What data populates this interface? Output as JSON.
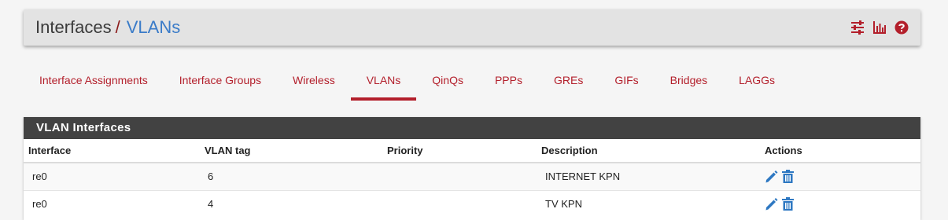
{
  "breadcrumb": {
    "base": "Interfaces",
    "separator": "/",
    "current": "VLANs"
  },
  "header_icons": [
    "settings-sliders-icon",
    "bar-chart-icon",
    "help-icon"
  ],
  "tabs": [
    {
      "label": "Interface Assignments",
      "active": false
    },
    {
      "label": "Interface Groups",
      "active": false
    },
    {
      "label": "Wireless",
      "active": false
    },
    {
      "label": "VLANs",
      "active": true
    },
    {
      "label": "QinQs",
      "active": false
    },
    {
      "label": "PPPs",
      "active": false
    },
    {
      "label": "GREs",
      "active": false
    },
    {
      "label": "GIFs",
      "active": false
    },
    {
      "label": "Bridges",
      "active": false
    },
    {
      "label": "LAGGs",
      "active": false
    }
  ],
  "panel": {
    "title": "VLAN Interfaces",
    "columns": [
      "Interface",
      "VLAN tag",
      "Priority",
      "Description",
      "Actions"
    ],
    "rows": [
      {
        "interface": "re0",
        "tag": "6",
        "priority": "",
        "description": "INTERNET KPN",
        "actions": [
          "edit-pencil-icon",
          "delete-trash-icon"
        ]
      },
      {
        "interface": "re0",
        "tag": "4",
        "priority": "",
        "description": "TV KPN",
        "actions": [
          "edit-pencil-icon",
          "delete-trash-icon"
        ]
      }
    ]
  },
  "colors": {
    "accent_red": "#b31f2b",
    "link_blue": "#3a7bc8",
    "panel_heading": "#424242",
    "action_blue": "#2e78c2"
  }
}
